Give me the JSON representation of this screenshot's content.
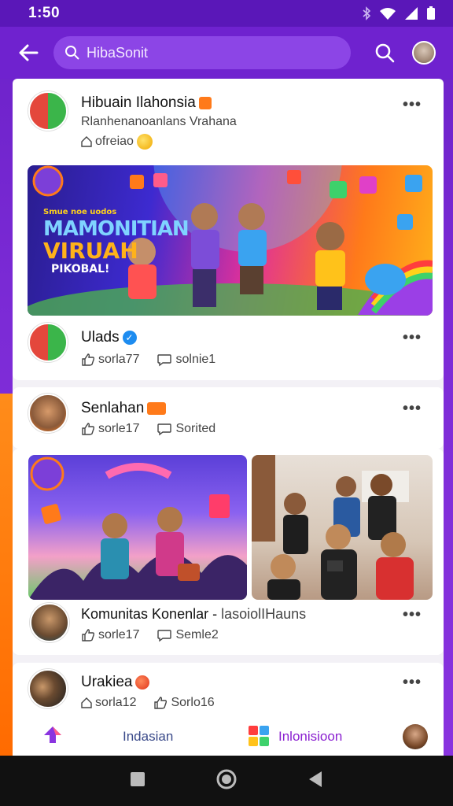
{
  "status": {
    "time": "1:50"
  },
  "search": {
    "query": "HibaSonit"
  },
  "posts": [
    {
      "name": "Hibuain Ilahonsia",
      "subtitle": "Rlanhenanoanlans Vrahana",
      "meta": "ofreiao"
    },
    {
      "name": "Ulads",
      "likes": "sorla77",
      "comments": "solnie1"
    },
    {
      "name": "Senlahan",
      "likes": "sorle17",
      "comments": "Sorited"
    },
    {
      "name": "Komunitas Konenlar",
      "subtitle": "lasoiolIHauns",
      "likes": "sorle17",
      "comments": "Semle2"
    },
    {
      "name": "Urakiea",
      "likes": "sorla12",
      "comments": "Sorlo16"
    }
  ],
  "banner": {
    "line1": "Smue noe uodos",
    "line2": "MAMONITIAN",
    "line3": "VIRUAH",
    "line4": "PIKOBAL!"
  },
  "bottom_tabs": {
    "tab1": "Indasian",
    "tab2": "Inlonisioon"
  },
  "colors": {
    "primary": "#6f22cf",
    "accent_orange": "#ff7a1a",
    "verified": "#1d8cf0"
  }
}
